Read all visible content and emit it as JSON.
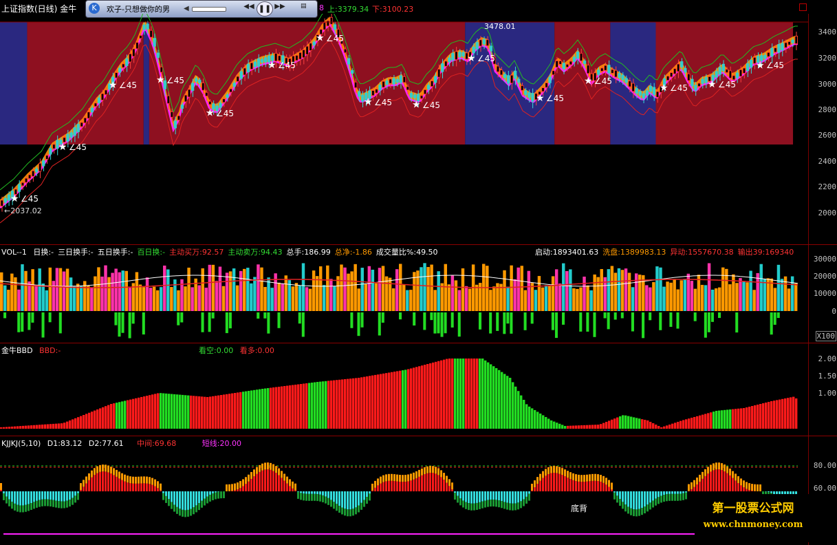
{
  "title": {
    "index_name": "上证指数(日线)",
    "indicator": "金牛"
  },
  "player": {
    "song": "欢子-只想做你的男",
    "up_text": "8",
    "up_label": "上:3379.34",
    "down_label": "下:3100.23"
  },
  "main_chart": {
    "peak_label": "3478.01",
    "low_label": "←2037.02",
    "angle_text": "∠45",
    "y_ticks": [
      "3400",
      "3200",
      "3000",
      "2800",
      "2600",
      "2400",
      "2200",
      "2000"
    ],
    "regimes": [
      {
        "color": "#2a2880",
        "from": 0,
        "to": 0.034
      },
      {
        "color": "#8e1020",
        "from": 0.034,
        "to": 0.18
      },
      {
        "color": "#2a2880",
        "from": 0.18,
        "to": 0.187
      },
      {
        "color": "#8e1020",
        "from": 0.187,
        "to": 0.583
      },
      {
        "color": "#2a2880",
        "from": 0.583,
        "to": 0.695
      },
      {
        "color": "#8e1020",
        "from": 0.695,
        "to": 0.765
      },
      {
        "color": "#2a2880",
        "from": 0.765,
        "to": 0.822
      },
      {
        "color": "#8e1020",
        "from": 0.822,
        "to": 0.994
      }
    ],
    "star_labels": [
      "∠45",
      "∠45",
      "∠45",
      "∠45",
      "∠45",
      "∠45",
      "∠45",
      "∠45",
      "∠45",
      "∠45",
      "∠45",
      "∠45",
      "∠45",
      "∠45",
      "∠45",
      "∠45"
    ]
  },
  "vol_panel": {
    "name": "VOL--1",
    "items": [
      {
        "text": "日换:-",
        "color": "#ffffff"
      },
      {
        "text": "三日换手:-",
        "color": "#ffffff"
      },
      {
        "text": "五日换手:-",
        "color": "#ffffff"
      },
      {
        "text": "百日换:-",
        "color": "#33dd33"
      },
      {
        "text": "主动买万:92.57",
        "color": "#ff3333"
      },
      {
        "text": "主动卖万:94.43",
        "color": "#33dd33"
      },
      {
        "text": "总手:186.99",
        "color": "#ffffff"
      },
      {
        "text": "总净:-1.86",
        "color": "#ff9900"
      },
      {
        "text": "成交量比%:49.50",
        "color": "#ffffff"
      }
    ],
    "right_items": [
      {
        "text": "启动:1893401.63",
        "color": "#ffffff"
      },
      {
        "text": "洗盘:1389983.13",
        "color": "#ff9900"
      },
      {
        "text": "异动:1557670.38",
        "color": "#ff3333"
      },
      {
        "text": "输出39:169340",
        "color": "#ff3333"
      }
    ],
    "y_ticks": [
      "30000",
      "20000",
      "10000",
      "0"
    ],
    "unit": "X100"
  },
  "bbd_panel": {
    "name": "金牛BBD",
    "bbd_label": "BBD:-",
    "short_label": "看空:0.00",
    "long_label": "看多:0.00",
    "y_ticks": [
      "2.00",
      "1.50",
      "1.00"
    ]
  },
  "kjkj_panel": {
    "name": "KJJKJ(5,10)",
    "d1": "D1:83.12",
    "d2": "D2:77.61",
    "mid": "中间:69.68",
    "short": "短线:20.00",
    "divergence": "底背",
    "y_ticks": [
      "80.00",
      "60.00"
    ]
  },
  "watermark": {
    "line1": "第一股票公式网",
    "line2": "www.chnmoney.com"
  },
  "colors": {
    "up": "#ff2020",
    "down": "#22cccc",
    "orange": "#ff9900",
    "green": "#22cc22",
    "magenta": "#ff22ff",
    "grid": "#8b0000"
  }
}
